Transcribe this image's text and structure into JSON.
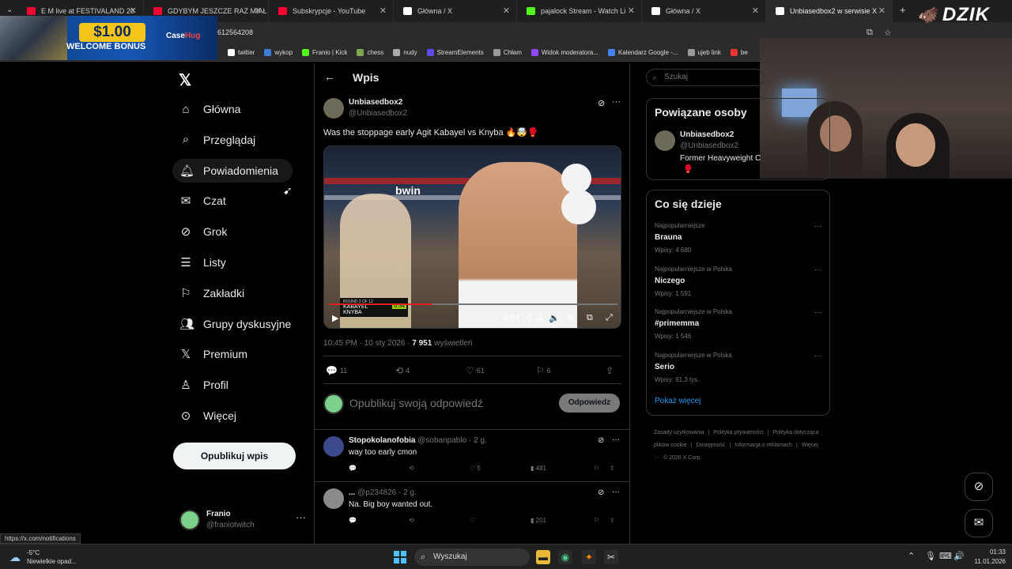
{
  "browser": {
    "tabs": [
      {
        "label": "E M live at FESTIVALAND 20",
        "fav_color": "#ff0033"
      },
      {
        "label": "GDYBYM JESZCZE RAZ MIAŁ U",
        "fav_color": "#ff0033"
      },
      {
        "label": "Subskrypcje - YouTube",
        "fav_color": "#ff0033"
      },
      {
        "label": "Główna / X",
        "fav_color": "#ffffff"
      },
      {
        "label": "pajalock Stream - Watch Li",
        "fav_color": "#53fc18"
      },
      {
        "label": "Główna / X",
        "fav_color": "#ffffff"
      },
      {
        "label": "Unbiasedbox2 w serwisie X",
        "fav_color": "#ffffff"
      }
    ],
    "url_fragment": "612564208",
    "bookmarks": [
      {
        "label": "twitter",
        "icon": "x-icon"
      },
      {
        "label": "wykop",
        "icon": "wykop-icon"
      },
      {
        "label": "Franio | Kick",
        "icon": "kick-icon"
      },
      {
        "label": "chess",
        "icon": "pawn-icon"
      },
      {
        "label": "nudy",
        "icon": "folder-icon"
      },
      {
        "label": "StreamElements",
        "icon": "streamelements-icon"
      },
      {
        "label": "Chłam",
        "icon": "globe-icon"
      },
      {
        "label": "Widok moderatora...",
        "icon": "twitch-icon"
      },
      {
        "label": "Kalendarz Google -...",
        "icon": "calendar-icon"
      },
      {
        "label": "ujeb link",
        "icon": "globe-icon"
      },
      {
        "label": "be",
        "icon": "bookmark-icon"
      }
    ],
    "status_tooltip": "https://x.com/notifications"
  },
  "ad": {
    "amount": "$1.00",
    "text": "WELCOME BONUS",
    "brand_a": "Case",
    "brand_b": "Hug"
  },
  "overlay": {
    "brand": "DZIK"
  },
  "nav": {
    "items": [
      {
        "label": "Główna",
        "icon": "home-icon"
      },
      {
        "label": "Przeglądaj",
        "icon": "search-icon"
      },
      {
        "label": "Powiadomienia",
        "icon": "bell-icon"
      },
      {
        "label": "Czat",
        "icon": "mail-icon"
      },
      {
        "label": "Grok",
        "icon": "grok-icon"
      },
      {
        "label": "Listy",
        "icon": "list-icon"
      },
      {
        "label": "Zakładki",
        "icon": "bookmark-icon"
      },
      {
        "label": "Grupy dyskusyjne",
        "icon": "people-icon"
      },
      {
        "label": "Premium",
        "icon": "x-icon"
      },
      {
        "label": "Profil",
        "icon": "person-icon"
      },
      {
        "label": "Więcej",
        "icon": "more-circle-icon"
      }
    ],
    "post_button": "Opublikuj wpis",
    "profile": {
      "name": "Franio",
      "handle": "@franiotwitch"
    }
  },
  "post": {
    "header_title": "Wpis",
    "author_name": "Unbiasedbox2",
    "author_handle": "@Unbiasedbox2",
    "text": "Was the stoppage early Agit Kabayel vs Knyba 🔥🤯🥊",
    "video": {
      "time": "0:04 / 0:11",
      "progress": 0.36,
      "sign": "bwin",
      "score_round": "ROUND 3 OF 12",
      "score_a": "KABAYEL",
      "score_b": "KNYBA",
      "score_time": "0:34"
    },
    "timestamp": "10:45 PM · 10 sty 2026 · ",
    "views": "7 951",
    "views_label": " wyświetleń",
    "stats": {
      "replies": "11",
      "reposts": "4",
      "likes": "61",
      "bookmarks": "6"
    },
    "reply_placeholder": "Opublikuj swoją odpowiedź",
    "reply_button": "Odpowiedz"
  },
  "comments": [
    {
      "name": "Stopokolanofobia",
      "handle": "@sobanpablo · 2 g.",
      "text": "way too early cmon",
      "likes": "5",
      "views": "481",
      "avatar_color": "#3b4a8a"
    },
    {
      "name": "...",
      "handle": "@p234826 · 2 g.",
      "text": "Na.  Big boy wanted out.",
      "likes": "",
      "views": "201",
      "avatar_color": "#8a8a8a"
    }
  ],
  "sidebar": {
    "search_placeholder": "Szukaj",
    "related_title": "Powiązane osoby",
    "related": {
      "name": "Unbiasedbox2",
      "handle": "@Unbiasedbox2",
      "bio": "Former Heavyweight C"
    },
    "trends_title": "Co się dzieje",
    "trends": [
      {
        "context": "Najpopularniejsze",
        "name": "Brauna",
        "posts": "Wpisy: 4 680"
      },
      {
        "context": "Najpopularniejsze w Polska",
        "name": "Niczego",
        "posts": "Wpisy: 1 591"
      },
      {
        "context": "Najpopularniejsze w Polska",
        "name": "#primemma",
        "posts": "Wpisy: 1 546"
      },
      {
        "context": "Najpopularniejsze w Polska",
        "name": "Serio",
        "posts": "Wpisy: 61,3 tys."
      }
    ],
    "show_more": "Pokaż więcej",
    "footer": [
      "Zasady użytkowania",
      "|",
      "Polityka prywatności",
      "|",
      "Polityka dotycząca plików cookie",
      "|",
      "Dostępność",
      "|",
      "Informacja o reklamach",
      "|",
      "Więcej ···",
      "© 2026 X Corp."
    ]
  },
  "taskbar": {
    "temp": "-5°C",
    "weather_desc": "Niewielkie opad...",
    "search_label": "Wyszukaj",
    "time": "01:33",
    "date": "11.01.2026"
  }
}
